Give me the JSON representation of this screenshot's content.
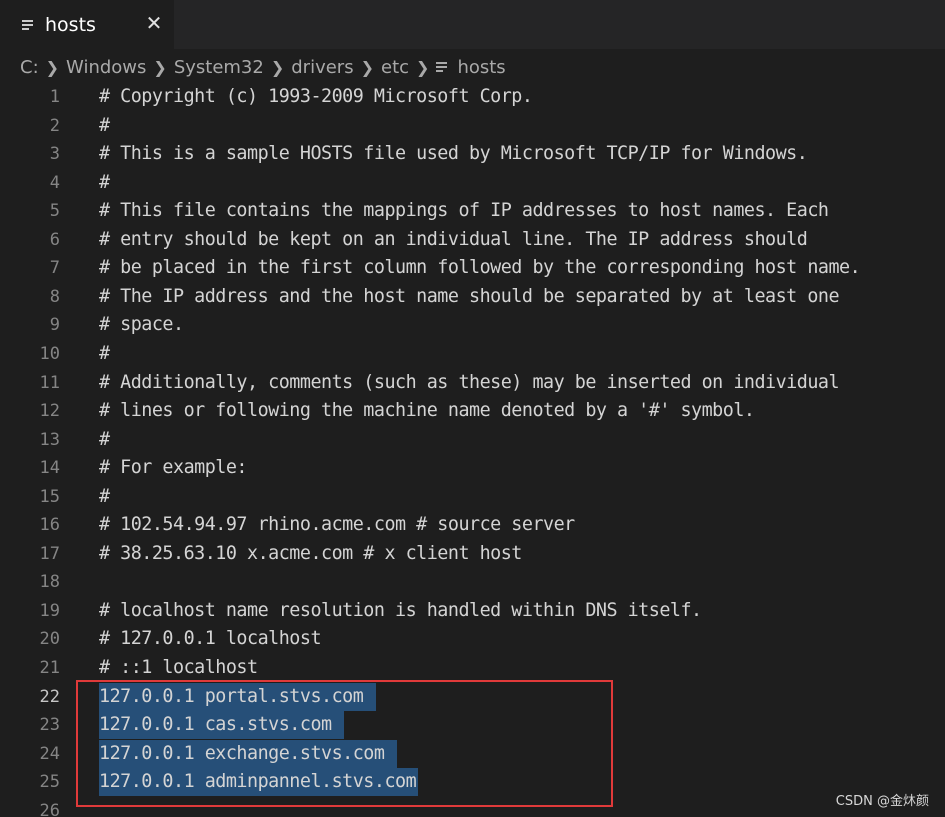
{
  "tab": {
    "title": "hosts",
    "close_glyph": "✕",
    "icon": "file-lines-icon"
  },
  "breadcrumb": [
    "C:",
    "Windows",
    "System32",
    "drivers",
    "etc",
    "hosts"
  ],
  "editor": {
    "active_line": 22,
    "selected_lines": [
      22,
      23,
      24,
      25
    ],
    "lines": [
      {
        "n": "1",
        "text": "# Copyright (c) 1993-2009 Microsoft Corp."
      },
      {
        "n": "2",
        "text": "#"
      },
      {
        "n": "3",
        "text": "# This is a sample HOSTS file used by Microsoft TCP/IP for Windows."
      },
      {
        "n": "4",
        "text": "#"
      },
      {
        "n": "5",
        "text": "# This file contains the mappings of IP addresses to host names. Each"
      },
      {
        "n": "6",
        "text": "# entry should be kept on an individual line. The IP address should"
      },
      {
        "n": "7",
        "text": "# be placed in the first column followed by the corresponding host name."
      },
      {
        "n": "8",
        "text": "# The IP address and the host name should be separated by at least one"
      },
      {
        "n": "9",
        "text": "# space."
      },
      {
        "n": "10",
        "text": "#"
      },
      {
        "n": "11",
        "text": "# Additionally, comments (such as these) may be inserted on individual"
      },
      {
        "n": "12",
        "text": "# lines or following the machine name denoted by a '#' symbol."
      },
      {
        "n": "13",
        "text": "#"
      },
      {
        "n": "14",
        "text": "# For example:"
      },
      {
        "n": "15",
        "text": "#"
      },
      {
        "n": "16",
        "text": "# 102.54.94.97 rhino.acme.com # source server"
      },
      {
        "n": "17",
        "text": "# 38.25.63.10 x.acme.com # x client host"
      },
      {
        "n": "18",
        "text": ""
      },
      {
        "n": "19",
        "text": "# localhost name resolution is handled within DNS itself."
      },
      {
        "n": "20",
        "text": "# 127.0.0.1 localhost"
      },
      {
        "n": "21",
        "text": "# ::1 localhost"
      },
      {
        "n": "22",
        "text": "127.0.0.1 portal.stvs.com "
      },
      {
        "n": "23",
        "text": "127.0.0.1 cas.stvs.com "
      },
      {
        "n": "24",
        "text": "127.0.0.1 exchange.stvs.com "
      },
      {
        "n": "25",
        "text": "127.0.0.1 adminpannel.stvs.com"
      },
      {
        "n": "26",
        "text": ""
      }
    ]
  },
  "colors": {
    "background": "#1e1e1e",
    "tab_bar": "#252526",
    "selection": "#264f78",
    "annotation_box": "#e03a3a"
  },
  "watermark": "CSDN @金炑颜"
}
